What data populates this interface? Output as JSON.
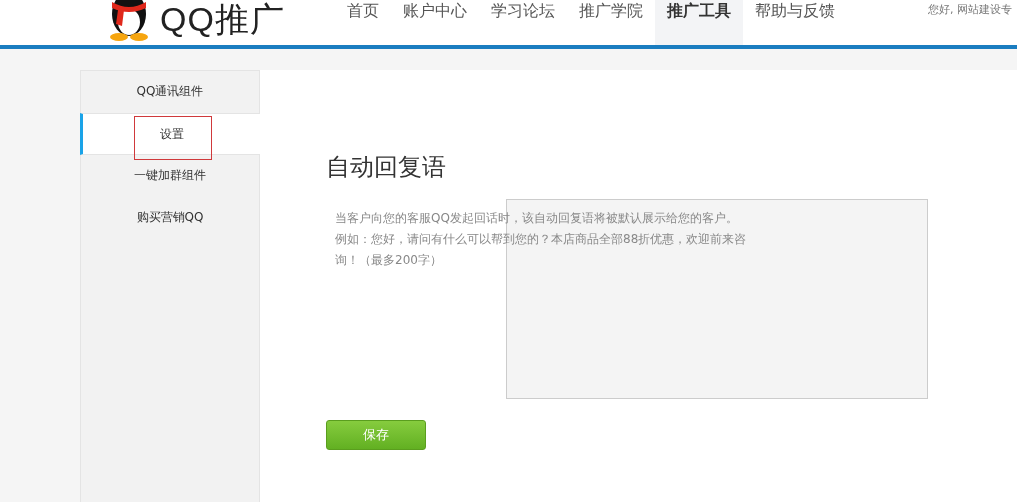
{
  "header": {
    "logo_text": "QQ推广",
    "nav": [
      {
        "label": "首页",
        "selected": false
      },
      {
        "label": "账户中心",
        "selected": false
      },
      {
        "label": "学习论坛",
        "selected": false
      },
      {
        "label": "推广学院",
        "selected": false
      },
      {
        "label": "推广工具",
        "selected": true
      },
      {
        "label": "帮助与反馈",
        "selected": false
      }
    ],
    "greeting": "您好, 网站建设专"
  },
  "sidebar": {
    "items": [
      {
        "label": "QQ通讯组件",
        "selected": false,
        "highlighted": false
      },
      {
        "label": "设置",
        "selected": true,
        "highlighted": true
      },
      {
        "label": "一键加群组件",
        "selected": false,
        "highlighted": false
      },
      {
        "label": "购买营销QQ",
        "selected": false,
        "highlighted": false
      }
    ]
  },
  "content": {
    "title": "自动回复语",
    "description": "当客户向您的客服QQ发起回话时，该自动回复语将被默认展示给您的客户。例如：您好，请问有什么可以帮到您的？本店商品全部88折优惠，欢迎前来咨询！（最多200字）",
    "save_button": "保存"
  }
}
